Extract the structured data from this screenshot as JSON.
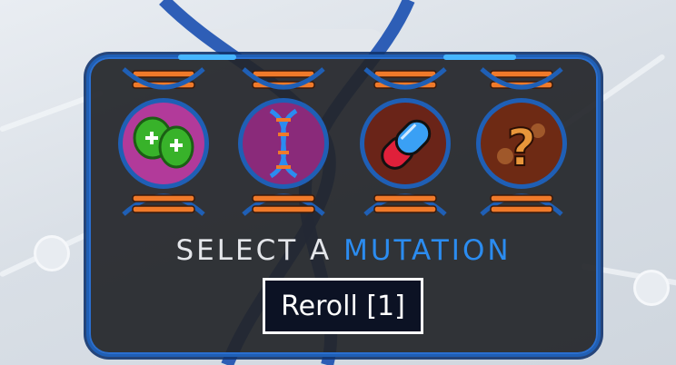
{
  "screen": {
    "title_prefix": "SELECT A ",
    "title_accent": "MUTATION",
    "reroll_label": "Reroll [1]"
  },
  "mutations": [
    {
      "icon": "green-cells-plus-icon",
      "color": "#b23a9a"
    },
    {
      "icon": "dna-helix-icon",
      "color": "#8a2a7a"
    },
    {
      "icon": "blue-pill-icon",
      "color": "#6a2418"
    },
    {
      "icon": "mystery-question-icon",
      "color": "#6e2a14"
    }
  ],
  "colors": {
    "accent_blue": "#2b8cf0",
    "frame_blue": "#1f5fb5",
    "rung_orange": "#f07a2a"
  }
}
